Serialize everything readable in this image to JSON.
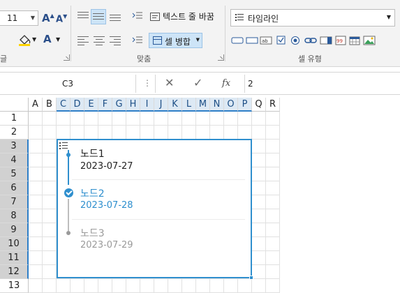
{
  "ribbon": {
    "font_size": "11",
    "grow_font": "A",
    "shrink_font": "A",
    "font_color_letter": "A",
    "wrap_text_label": "텍스트 줄 바꿈",
    "merge_label": "셀 병합",
    "align_group_label": "맞춤",
    "cell_type_value": "타임라인",
    "cell_type_group_label": "셀 유형",
    "left_group_fragment": "글"
  },
  "formula_bar": {
    "name_box": "C3",
    "dots": "⋮",
    "cancel": "✕",
    "confirm": "✓",
    "fx": "fx",
    "value": "2"
  },
  "sheet": {
    "columns": [
      "A",
      "B",
      "C",
      "D",
      "E",
      "F",
      "G",
      "H",
      "I",
      "J",
      "K",
      "L",
      "M",
      "N",
      "O",
      "P",
      "Q",
      "R"
    ],
    "rows": [
      "1",
      "2",
      "3",
      "4",
      "5",
      "6",
      "7",
      "8",
      "9",
      "10",
      "11",
      "12",
      "13"
    ]
  },
  "timeline": {
    "nodes": [
      {
        "title": "노드1",
        "date": "2023-07-27",
        "state": "done"
      },
      {
        "title": "노드2",
        "date": "2023-07-28",
        "state": "current"
      },
      {
        "title": "노드3",
        "date": "2023-07-29",
        "state": "pending"
      }
    ],
    "colors": {
      "accent": "#2f8fce",
      "done": "#222222",
      "pending": "#9a9a9a"
    }
  }
}
